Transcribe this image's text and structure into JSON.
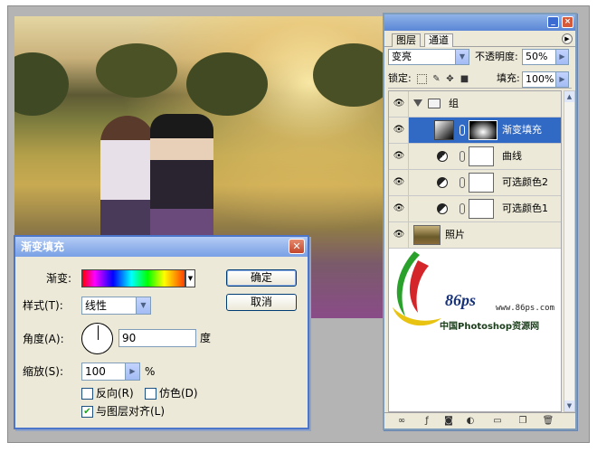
{
  "layers_panel": {
    "tabs": [
      "图层",
      "通道"
    ],
    "blend_mode": "变亮",
    "opacity_label": "不透明度:",
    "opacity_value": "50%",
    "lock_label": "锁定:",
    "fill_label": "填充:",
    "fill_value": "100%",
    "layers": [
      {
        "name": "组",
        "kind": "group"
      },
      {
        "name": "渐变填充",
        "kind": "gradient-fill",
        "selected": true
      },
      {
        "name": "曲线",
        "kind": "adjustment"
      },
      {
        "name": "可选颜色2",
        "kind": "adjustment"
      },
      {
        "name": "可选颜色1",
        "kind": "adjustment"
      },
      {
        "name": "照片",
        "kind": "photo"
      }
    ]
  },
  "watermark": {
    "site": "www.86ps.com",
    "brand": "86ps",
    "caption": "中国Photoshop资源网"
  },
  "dialog": {
    "title": "渐变填充",
    "gradient_label": "渐变:",
    "style_label": "样式(T):",
    "style_value": "线性",
    "angle_label": "角度(A):",
    "angle_value": "90",
    "angle_unit": "度",
    "scale_label": "缩放(S):",
    "scale_value": "100",
    "scale_unit": "%",
    "reverse_label": "反向(R)",
    "dither_label": "仿色(D)",
    "align_label": "与图层对齐(L)",
    "reverse_checked": false,
    "dither_checked": false,
    "align_checked": true,
    "ok_label": "确定",
    "cancel_label": "取消"
  },
  "colors": {
    "selected_row": "#316ac5",
    "title_blue": "#7aa1e6",
    "panel_bg": "#ece9d8"
  }
}
